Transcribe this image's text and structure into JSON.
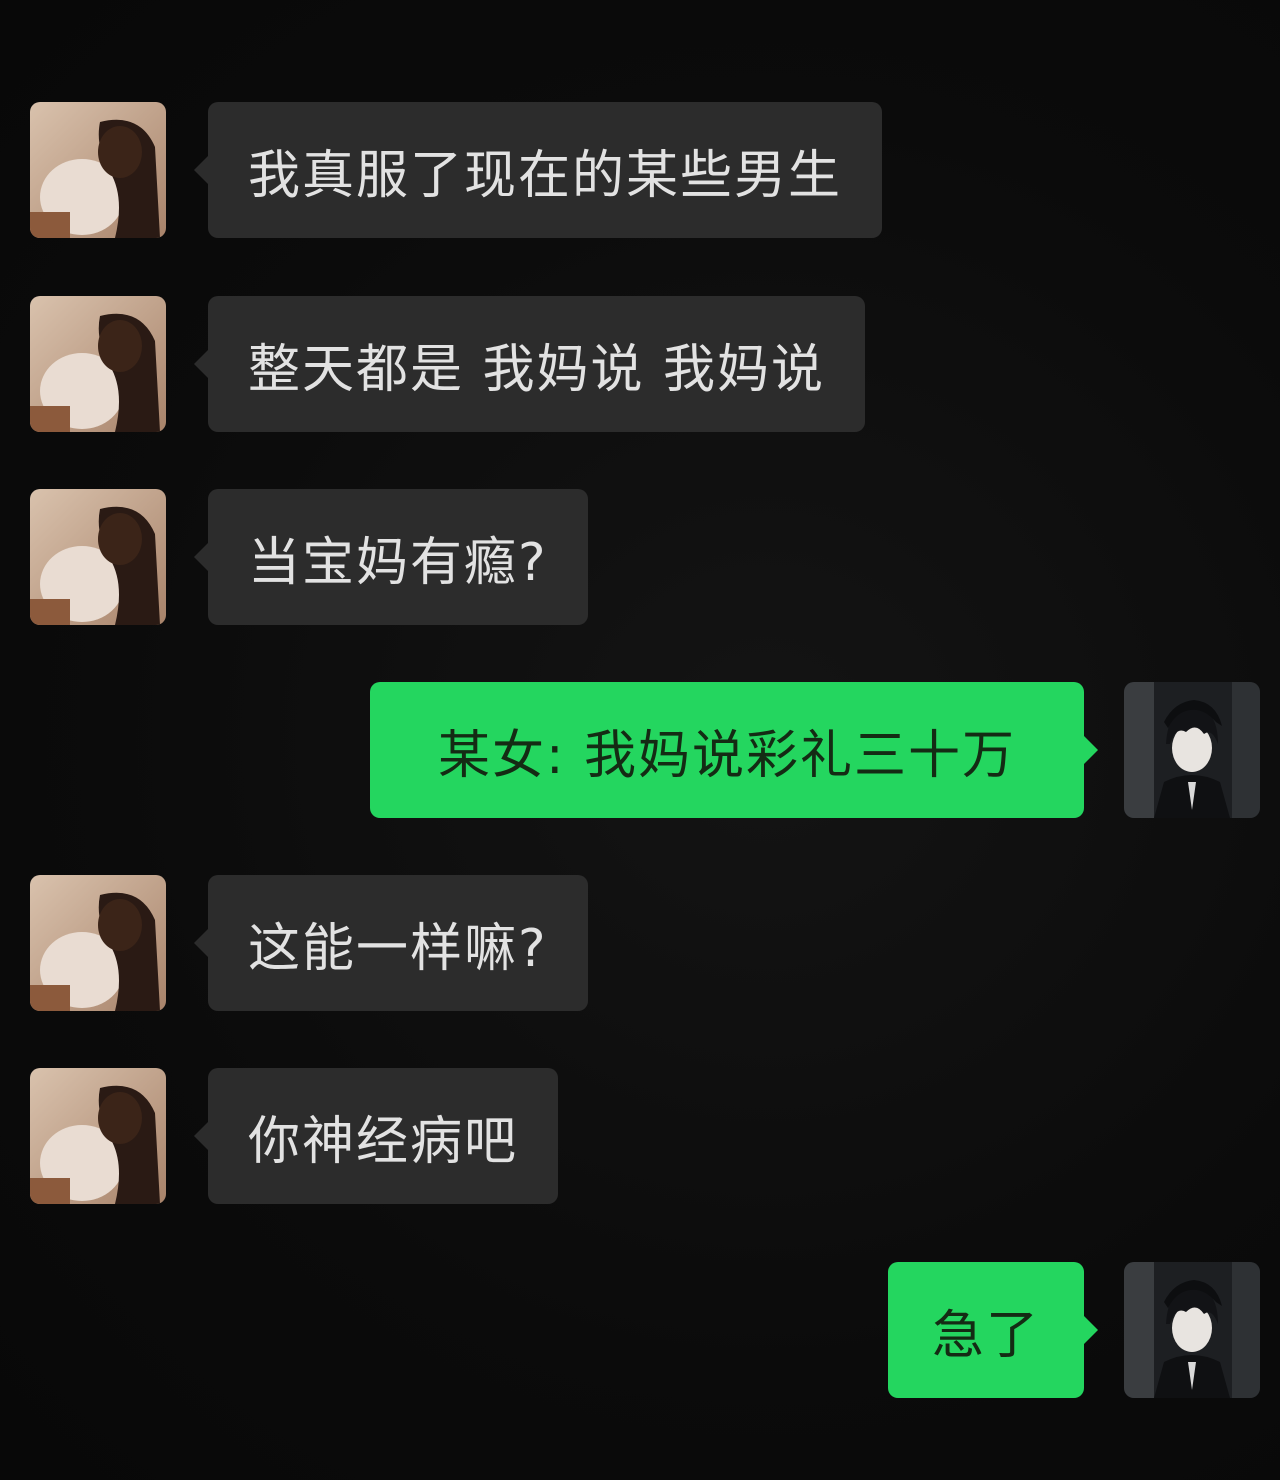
{
  "messages": [
    {
      "side": "in",
      "text": "我真服了现在的某些男生"
    },
    {
      "side": "in",
      "text": "整天都是 我妈说 我妈说"
    },
    {
      "side": "in",
      "text": "当宝妈有瘾?"
    },
    {
      "side": "out",
      "text": "某女: 我妈说彩礼三十万"
    },
    {
      "side": "in",
      "text": "这能一样嘛?"
    },
    {
      "side": "in",
      "text": "你神经病吧"
    },
    {
      "side": "out",
      "text": "急了"
    }
  ],
  "avatars": {
    "left": "female-avatar-icon",
    "right": "anime-boy-avatar-icon"
  },
  "colors": {
    "background": "#0c0c0c",
    "incoming_bubble": "#2c2c2c",
    "outgoing_bubble": "#24d65f"
  }
}
